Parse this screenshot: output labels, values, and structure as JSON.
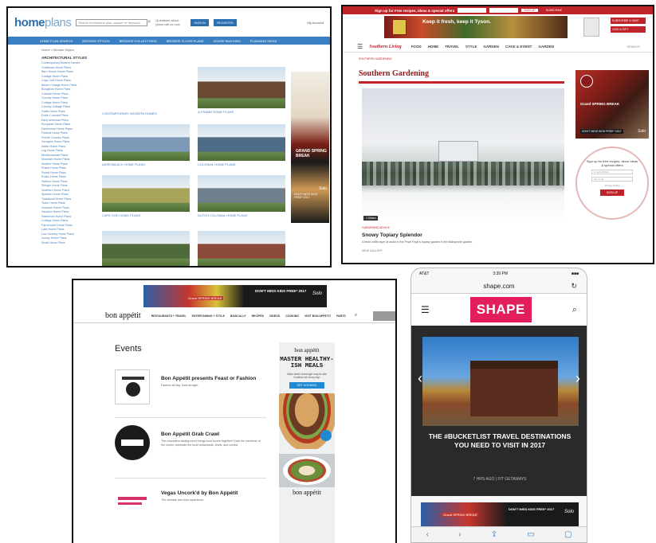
{
  "homeplans": {
    "logo_main": "home",
    "logo_light": "plans",
    "search_placeholder": "Search homeplans plan number or keyword",
    "help_text": "Questions about plans call us now",
    "btn_login": "SIGN IN",
    "btn_register": "REGISTER",
    "account": "My Account",
    "nav": [
      "HOME PLAN SEARCH",
      "BROWSE STYLES",
      "BROWSE COLLECTIONS",
      "BROWSE FLOOR PLANS",
      "HOUSE BUILDING",
      "PLANNING IDEAS"
    ],
    "breadcrumb": "Home > Browse Styles",
    "sidebar_title": "ARCHITECTURAL STYLES",
    "sidebar_items": [
      "Contemporary Modern Homes",
      "Craftsman Home Plans",
      "Barn House Home Plans",
      "Cottage Home Plans",
      "Cape Cod Home Plans",
      "Beach Cottage Home Plans",
      "Bungalow Home Plans",
      "Colonial Home Plans",
      "Country Home Plans",
      "Cottage Home Plans",
      "Country Cottage Plans",
      "Cabin Home Plans",
      "Dutch Colonial Plans",
      "Early American Plans",
      "European Home Plans",
      "Farmhouse Home Plans",
      "Federal Home Plans",
      "French Country Plans",
      "Georgian Home Plans",
      "Italian Home Plans",
      "Log Home Plans",
      "Mediterranean Plans",
      "Mountain Home Plans",
      "Modern Home Plans",
      "Prairie Home Plans",
      "Ranch Home Plans",
      "Rustic Home Plans",
      "Saltbox Home Plans",
      "Shingle Home Plans",
      "Southern Home Plans",
      "Spanish Home Plans",
      "Traditional Home Plans",
      "Tudor Home Plans",
      "Victorian Home Plans",
      "Vacation Home Plans",
      "Waterfront Home Plans",
      "Cottage Home Plans",
      "Farmhouse Home Plans",
      "Lake Home Plans",
      "Low Country Home Plans",
      "Luxury Home Plans",
      "Small Home Plans"
    ],
    "cards": [
      {
        "caption": "",
        "color": "#6e8f4e"
      },
      {
        "caption": "A-FRAME HOME PLANS",
        "color": "#6b4a33"
      },
      {
        "caption": "ADIRONDACK HOME PLANS",
        "color": "#7c9ab8"
      },
      {
        "caption": "COLONIAL HOME PLANS",
        "color": "#4e6c86"
      },
      {
        "caption": "CAPE COD HOME PLANS",
        "color": "#a9a45c"
      },
      {
        "caption": "DUTCH COLONIAL HOME PLANS",
        "color": "#6f7f8c"
      },
      {
        "caption": "",
        "color": "#4f6b3b"
      },
      {
        "caption": "",
        "color": "#8c4a3a"
      }
    ],
    "first_caption": "CONTEMPORARY MODERN HOMES",
    "ad_text": "GRAND SPRING BREAK",
    "ad_sig": "Solo",
    "ad_sub": "DON'T MISS KIDS FREE* 2017"
  },
  "southern": {
    "top_msg": "Sign up for Free recipes, ideas & special offers",
    "top_btn": "SIGN UP",
    "top_sub": "SUBSCRIBE",
    "banner_text": "Keep it fresh, keep it Tyson.",
    "red_btns": [
      "SUBSCRIBE & SAVE",
      "GIVE A GIFT"
    ],
    "logo": "Southern Living",
    "nav": [
      "FOOD",
      "HOME",
      "TRAVEL",
      "STYLE",
      "GARDEN",
      "CAKE & EVENT",
      "GARDEN"
    ],
    "search": "SEARCH",
    "crumb": "SOUTHERN GARDENING",
    "title": "Southern Gardening",
    "hero_tag": "1 Slides",
    "cap_small": "GARDENING ADVICE",
    "caption": "Snowy Topiary Splendor",
    "caption_desc": "A fresh white layer of snow in the Pearl Fryar's topiary garden in the Bishopville garden.",
    "more": "VIEW GALLERY",
    "ad_title": "Grand SPRING BREAK",
    "ad_sub": "DON'T MISS KIDS FREE* 2017",
    "ad_sig": "Solo",
    "signup_head": "Sign up for free recipes, decor ideas & special offers",
    "signup_email": "Email Address",
    "signup_zip": "Zip Code",
    "signup_privacy": "Privacy Policy",
    "signup_btn": "SIGN UP"
  },
  "bonappetit": {
    "banner_t1": "Grand SPRING BREAK",
    "banner_t2": "DON'T MISS KIDS FREE* 2017",
    "banner_sig": "Solo",
    "logo": "bon appétit",
    "nav": [
      "RESTAURANTS + TRAVEL",
      "ENTERTAINING + STYLE",
      "BASICALLY",
      "RECIPES",
      "VIDEOS",
      "COOKING",
      "VISIT BON APPETIT",
      "PARTS"
    ],
    "events_title": "Events",
    "events": [
      {
        "name": "Bon Appétit presents Feast or Fashion",
        "desc": "Fashion all day, food all night."
      },
      {
        "name": "Bon Appétit Grab Crawl",
        "desc": "This innovative tasting event brings food lovers together! Grab the members of the crowd, celebrate the local restaurants, chefs, and cuisine."
      },
      {
        "name": "Vegas Uncork'd by Bon Appétit",
        "desc": "The ultimate and food experience."
      }
    ],
    "ad_logo": "bon appétit",
    "ad_head": "MASTER HEALTHY-ISH MEALS",
    "ad_small": "Make better weeknight recipes with healthier-ish every day!",
    "ad_cta": "GET COOKING",
    "ad_logo2": "bon appétit"
  },
  "shape": {
    "carrier": "AT&T",
    "time": "3:39 PM",
    "battery": "■■■",
    "url": "shape.com",
    "reload_icon": "↻",
    "logo": "SHAPE",
    "headline": "THE #BUCKETLIST TRAVEL DESTINATIONS YOU NEED TO VISIT IN 2017",
    "meta": "7 HRS AGO | FIT GETAWAYS",
    "ad_t1": "Grand SPRING BREAK",
    "ad_t2": "DON'T MISS KIDS FREE* 2017",
    "ad_sig": "Solo",
    "toolbar": [
      "‹",
      "›",
      "⇪",
      "▭",
      "▢"
    ]
  }
}
